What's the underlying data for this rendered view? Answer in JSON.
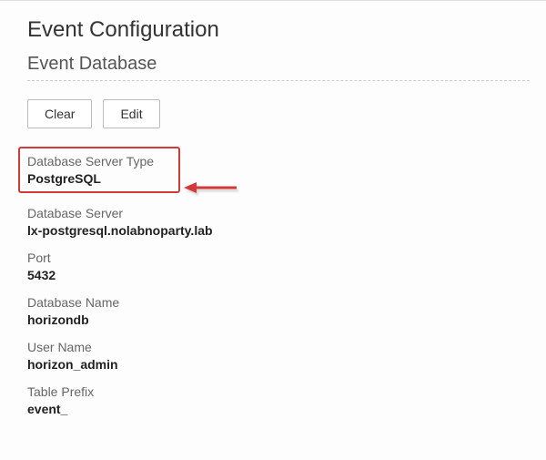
{
  "page": {
    "title": "Event Configuration",
    "section": "Event Database"
  },
  "buttons": {
    "clear": "Clear",
    "edit": "Edit"
  },
  "fields": {
    "db_server_type": {
      "label": "Database Server Type",
      "value": "PostgreSQL"
    },
    "db_server": {
      "label": "Database Server",
      "value": "lx-postgresql.nolabnoparty.lab"
    },
    "port": {
      "label": "Port",
      "value": "5432"
    },
    "db_name": {
      "label": "Database Name",
      "value": "horizondb"
    },
    "user": {
      "label": "User Name",
      "value": "horizon_admin"
    },
    "prefix": {
      "label": "Table Prefix",
      "value": "event_"
    }
  }
}
